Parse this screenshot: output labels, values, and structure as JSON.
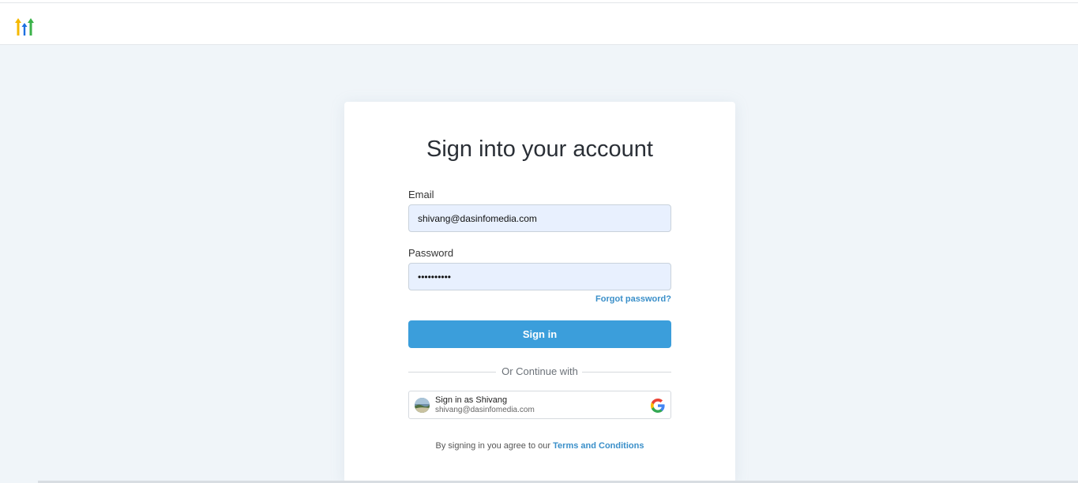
{
  "header": {
    "logo_icon": "gohighlevel-arrows-logo-icon"
  },
  "login": {
    "title": "Sign into your account",
    "email_label": "Email",
    "email_value": "shivang@dasinfomedia.com",
    "password_label": "Password",
    "password_value": "••••••••••",
    "forgot_label": "Forgot password?",
    "signin_label": "Sign in",
    "divider_text": "Or Continue with",
    "google": {
      "title": "Sign in as Shivang",
      "email": "shivang@dasinfomedia.com",
      "icon": "google-g-icon",
      "avatar_icon": "profile-avatar"
    },
    "terms_prefix": "By signing in you agree to our",
    "terms_link": "Terms and Conditions"
  },
  "colors": {
    "accent": "#3b9edb",
    "link": "#3a8fc9",
    "background": "#f0f5f9",
    "input_fill": "#e8f0fe"
  }
}
